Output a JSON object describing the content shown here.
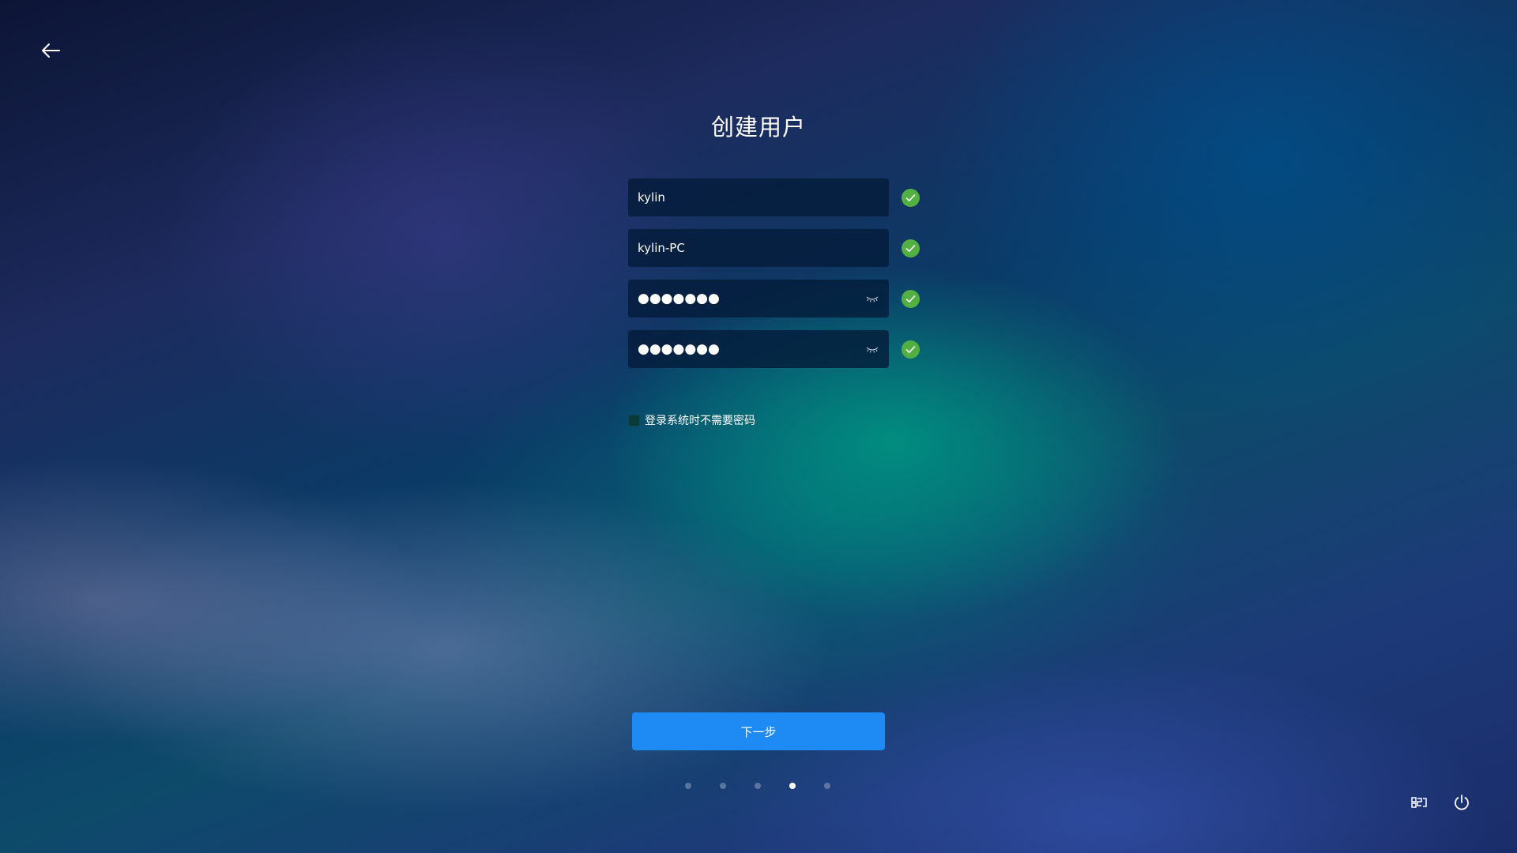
{
  "page": {
    "title": "创建用户"
  },
  "form": {
    "username": {
      "value": "kylin",
      "valid": true
    },
    "hostname": {
      "value": "kylin-PC",
      "valid": true
    },
    "password": {
      "masked_value": "●●●●●●●",
      "valid": true
    },
    "confirm_password": {
      "masked_value": "●●●●●●●",
      "valid": true
    }
  },
  "options": {
    "no_password_login": {
      "label": "登录系统时不需要密码",
      "checked": false
    }
  },
  "actions": {
    "next_label": "下一步"
  },
  "steps": {
    "total": 5,
    "current": 4
  },
  "icons": {
    "back": "arrow-left-icon",
    "valid": "check-circle-icon",
    "password_visibility": "eye-closed-icon",
    "keyboard": "keyboard-icon",
    "power": "power-icon"
  },
  "colors": {
    "accent": "#1e8bf5",
    "valid": "#52b043",
    "field_bg": "#041c3a"
  }
}
